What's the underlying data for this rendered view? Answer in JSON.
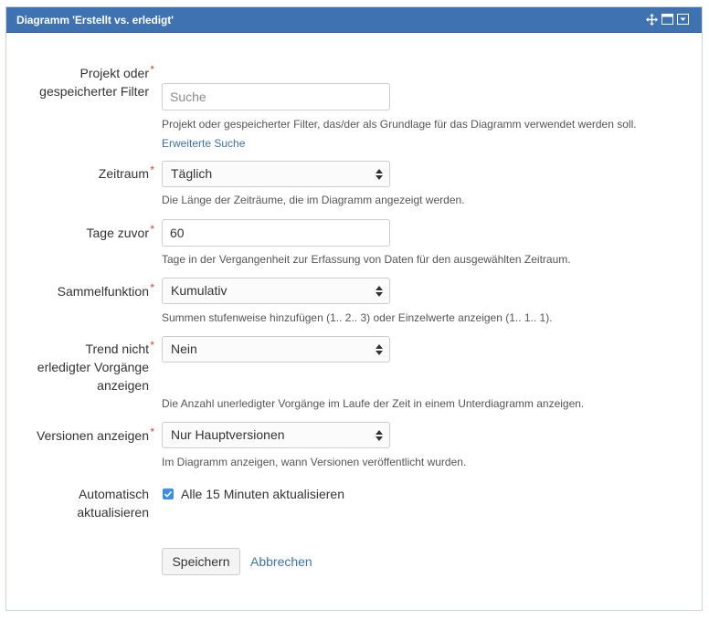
{
  "gadget": {
    "title": "Diagramm 'Erstellt vs. erledigt'",
    "icons": [
      "move-icon",
      "maximize-icon",
      "menu-dropdown-icon"
    ],
    "header_color": "#3f72b1"
  },
  "form": {
    "project": {
      "label_line1": "Projekt oder",
      "label_line2": "gespeicherter Filter",
      "required": "*",
      "placeholder": "Suche",
      "description": "Projekt oder gespeicherter Filter, das/der als Grundlage für das Diagramm verwendet werden soll.",
      "advanced_search": "Erweiterte Suche"
    },
    "period": {
      "label": "Zeitraum",
      "required": "*",
      "value": "Täglich",
      "description": "Die Länge der Zeiträume, die im Diagramm angezeigt werden."
    },
    "days_before": {
      "label": "Tage zuvor",
      "required": "*",
      "value": "60",
      "description": "Tage in der Vergangenheit zur Erfassung von Daten für den ausgewählten Zeitraum."
    },
    "aggregation": {
      "label": "Sammelfunktion",
      "required": "*",
      "value": "Kumulativ",
      "description": "Summen stufenweise hinzufügen (1.. 2.. 3) oder Einzelwerte anzeigen (1.. 1.. 1)."
    },
    "trend": {
      "label_line1": "Trend nicht",
      "label_line2": "erledigter Vorgänge",
      "label_line3": "anzeigen",
      "required": "*",
      "value": "Nein",
      "description": "Die Anzahl unerledigter Vorgänge im Laufe der Zeit in einem Unterdiagramm anzeigen."
    },
    "versions": {
      "label": "Versionen anzeigen",
      "required": "*",
      "value": "Nur Hauptversionen",
      "description": "Im Diagramm anzeigen, wann Versionen veröffentlicht wurden."
    },
    "auto_refresh": {
      "label_line1": "Automatisch",
      "label_line2": "aktualisieren",
      "checked": true,
      "checkbox_label": "Alle 15 Minuten aktualisieren"
    },
    "save_button": "Speichern",
    "cancel_link": "Abbrechen"
  },
  "colors": {
    "accent": "#3b73af",
    "required": "#d04437",
    "checkbox": "#3b8fe4"
  }
}
